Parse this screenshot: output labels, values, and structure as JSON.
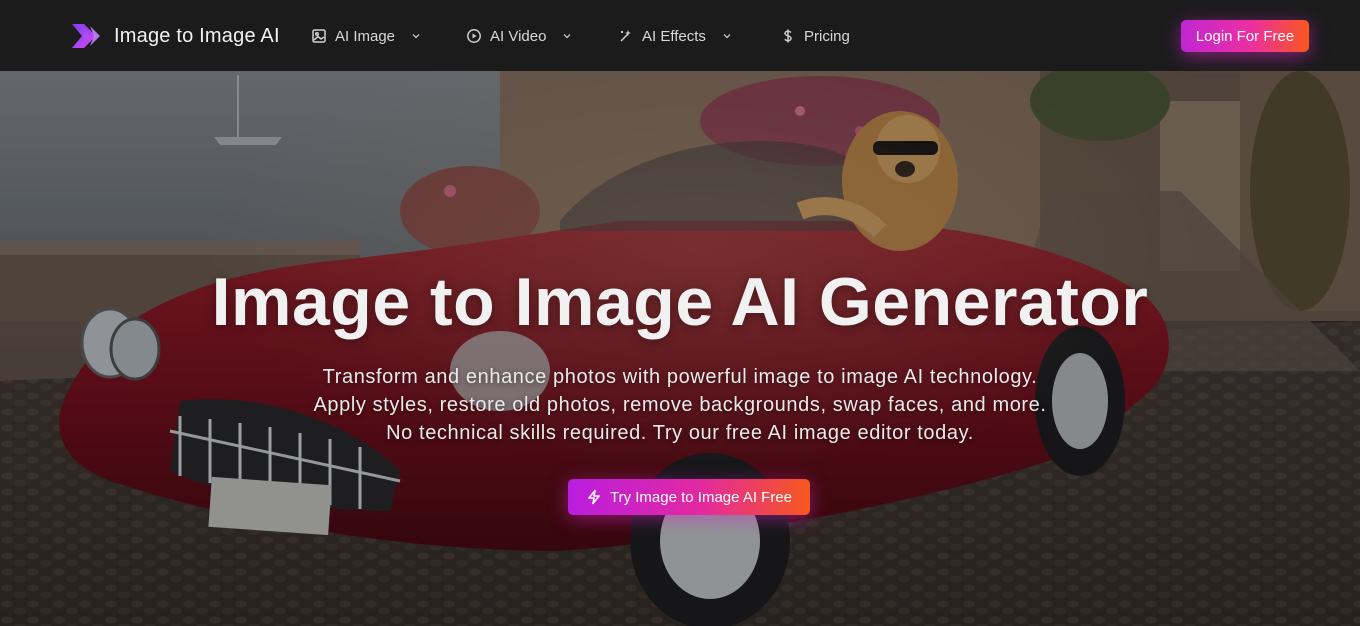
{
  "nav": {
    "brand": "Image to Image AI",
    "brand_icon": "chevron-logo-icon",
    "items": [
      {
        "label": "AI Image",
        "icon": "image-icon",
        "dropdown": true
      },
      {
        "label": "AI Video",
        "icon": "play-circle-icon",
        "dropdown": true
      },
      {
        "label": "AI Effects",
        "icon": "magic-wand-icon",
        "dropdown": true
      },
      {
        "label": "Pricing",
        "icon": "dollar-icon",
        "dropdown": false
      }
    ],
    "login_label": "Login For Free"
  },
  "hero": {
    "title": "Image to Image AI Generator",
    "subtitle_lines": [
      "Transform and enhance photos with powerful image to image AI technology.",
      "Apply styles, restore old photos, remove backgrounds, swap faces, and more.",
      "No technical skills required. Try our free AI image editor today."
    ],
    "cta_label": "Try Image to Image AI Free",
    "cta_icon": "lightning-icon"
  },
  "colors": {
    "nav_bg": "#1b1b1c",
    "gradient_start": "#c026d3",
    "gradient_mid": "#ec2fa0",
    "gradient_end": "#f9571e",
    "logo_start": "#7b3ff2",
    "logo_end": "#d946ef"
  }
}
